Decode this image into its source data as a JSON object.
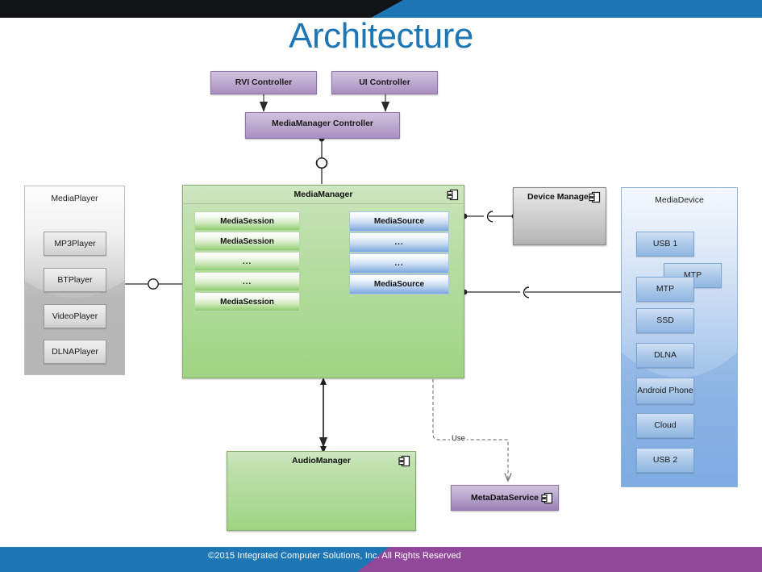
{
  "slide": {
    "title": "Architecture",
    "title_color": "#1f76b4",
    "topbar": {
      "dark_color": "#0d0f11",
      "accent_color": "#1f76b4"
    },
    "footer": {
      "text": "©2015 Integrated Computer Solutions, Inc. All Rights Reserved",
      "blue_color": "#1f76b4",
      "purple_color": "#91489b"
    }
  },
  "controllers": {
    "rvi": "RVI Controller",
    "ui": "UI Controller",
    "mediamanager": "MediaManager Controller"
  },
  "media_player_panel": {
    "title": "MediaPlayer",
    "items": [
      "MP3Player",
      "BTPlayer",
      "VideoPlayer",
      "DLNAPlayer"
    ]
  },
  "media_manager": {
    "title": "MediaManager",
    "sessions": [
      "MediaSession",
      "MediaSession",
      "...",
      "...",
      "MediaSession"
    ],
    "sources": [
      "MediaSource",
      "...",
      "...",
      "MediaSource"
    ]
  },
  "device_manager": {
    "title": "Device Manager"
  },
  "media_device_panel": {
    "title": "MediaDevice",
    "items": [
      "USB 1",
      "MTP",
      "MTP",
      "SSD",
      "DLNA",
      "Android Phone",
      "Cloud",
      "USB 2"
    ]
  },
  "audio_manager": {
    "title": "AudioManager"
  },
  "meta_data_service": {
    "title": "MetaDataService"
  },
  "relations": {
    "use_label": "Use"
  }
}
